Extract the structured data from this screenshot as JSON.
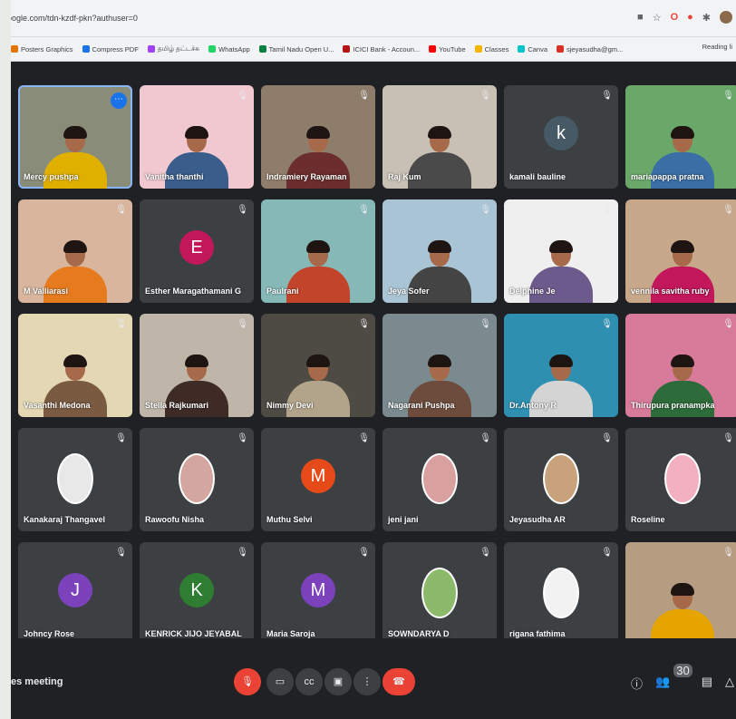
{
  "browser": {
    "url": "oogle.com/tdn-kzdf-pkn?authuser=0",
    "bookmarks": [
      "Posters Graphics",
      "Compress PDF",
      "தமிழ் தட்டச்சு",
      "WhatsApp",
      "Tamil Nadu Open U...",
      "ICICI Bank - Accoun...",
      "YouTube",
      "Classes",
      "Canva",
      "sjeyasudha@gm..."
    ],
    "bookmarks_end": "Reading li"
  },
  "tiles": [
    {
      "name": "Mercy pushpa",
      "kind": "video",
      "bg": "#8a8c7a",
      "body": "#e0b000",
      "active": true
    },
    {
      "name": "Vanitha thanthi",
      "kind": "video",
      "bg": "#f1c7d0",
      "body": "#3a5d8c"
    },
    {
      "name": "Indramiery Rayaman",
      "kind": "video",
      "bg": "#8e7d6a",
      "body": "#6b2d2d"
    },
    {
      "name": "Raj Kum",
      "kind": "video",
      "bg": "#c8c0b4",
      "body": "#4a4a4a"
    },
    {
      "name": "kamali bauline",
      "kind": "initial",
      "initial": "k",
      "color": "#455a64"
    },
    {
      "name": "mariapappa pratna",
      "kind": "video",
      "bg": "#6aa86a",
      "body": "#3a6ea5"
    },
    {
      "name": "M Valliarasi",
      "kind": "video",
      "bg": "#d8b59c",
      "body": "#e67a1e"
    },
    {
      "name": "Esther Maragathamani G",
      "kind": "initial",
      "initial": "E",
      "color": "#c2185b"
    },
    {
      "name": "Paulrani",
      "kind": "video",
      "bg": "#86b8b8",
      "body": "#c2442b"
    },
    {
      "name": "Jeya Sofer",
      "kind": "video",
      "bg": "#a9c4d4",
      "body": "#444"
    },
    {
      "name": "Delphine Je",
      "kind": "video",
      "bg": "#efefef",
      "body": "#6d5a8c"
    },
    {
      "name": "vennila savitha ruby",
      "kind": "video",
      "bg": "#c8a88a",
      "body": "#c2185b"
    },
    {
      "name": "Vasanthi Medona",
      "kind": "video",
      "bg": "#e4d8b4",
      "body": "#7a5a40"
    },
    {
      "name": "Stella Rajkumari",
      "kind": "video",
      "bg": "#bfb5a8",
      "body": "#3e2b26"
    },
    {
      "name": "Nimmy Devi",
      "kind": "video",
      "bg": "#4e4a44",
      "body": "#b2a48a"
    },
    {
      "name": "Nagarani Pushpa",
      "kind": "video",
      "bg": "#7a8a8e",
      "body": "#6d4c3d"
    },
    {
      "name": "Dr.Antony R",
      "kind": "video",
      "bg": "#2e8fb0",
      "body": "#d4d4d4"
    },
    {
      "name": "Thirupura pranampka",
      "kind": "video",
      "bg": "#d87a9a",
      "body": "#2d6b3a"
    },
    {
      "name": "Kanakaraj Thangavel",
      "kind": "photo",
      "photo_bg": "#e8e8e8"
    },
    {
      "name": "Rawoofu Nisha",
      "kind": "photo",
      "photo_bg": "#d4a6a0"
    },
    {
      "name": "Muthu Selvi",
      "kind": "initial",
      "initial": "M",
      "color": "#e64a19"
    },
    {
      "name": "jeni jani",
      "kind": "photo",
      "photo_bg": "#d9a0a0"
    },
    {
      "name": "Jeyasudha AR",
      "kind": "photo",
      "photo_bg": "#c8a27a"
    },
    {
      "name": "Roseline",
      "kind": "photo",
      "photo_bg": "#f3b0c0"
    },
    {
      "name": "Johncy Rose",
      "kind": "initial",
      "initial": "J",
      "color": "#7b42bc"
    },
    {
      "name": "KENRICK JIJO JEYABAL",
      "kind": "initial",
      "initial": "K",
      "color": "#2e7d32"
    },
    {
      "name": "Maria Saroja",
      "kind": "initial",
      "initial": "M",
      "color": "#7b42bc"
    },
    {
      "name": "SOWNDARYA D",
      "kind": "photo",
      "photo_bg": "#8aba6a"
    },
    {
      "name": "rigana fathima",
      "kind": "photo",
      "photo_bg": "#f2f2f2"
    },
    {
      "name": "",
      "kind": "video",
      "bg": "#b69c80",
      "body": "#e6a400"
    }
  ],
  "bottom": {
    "meeting_title": "es meeting",
    "participants_count": "30",
    "controls": [
      "mic-off",
      "camera",
      "captions",
      "present",
      "more",
      "leave"
    ]
  },
  "colors": {
    "meet_bg": "#202124",
    "tile_bg": "#3c4043",
    "red": "#ea4335",
    "active_border": "#8ab4f8"
  }
}
